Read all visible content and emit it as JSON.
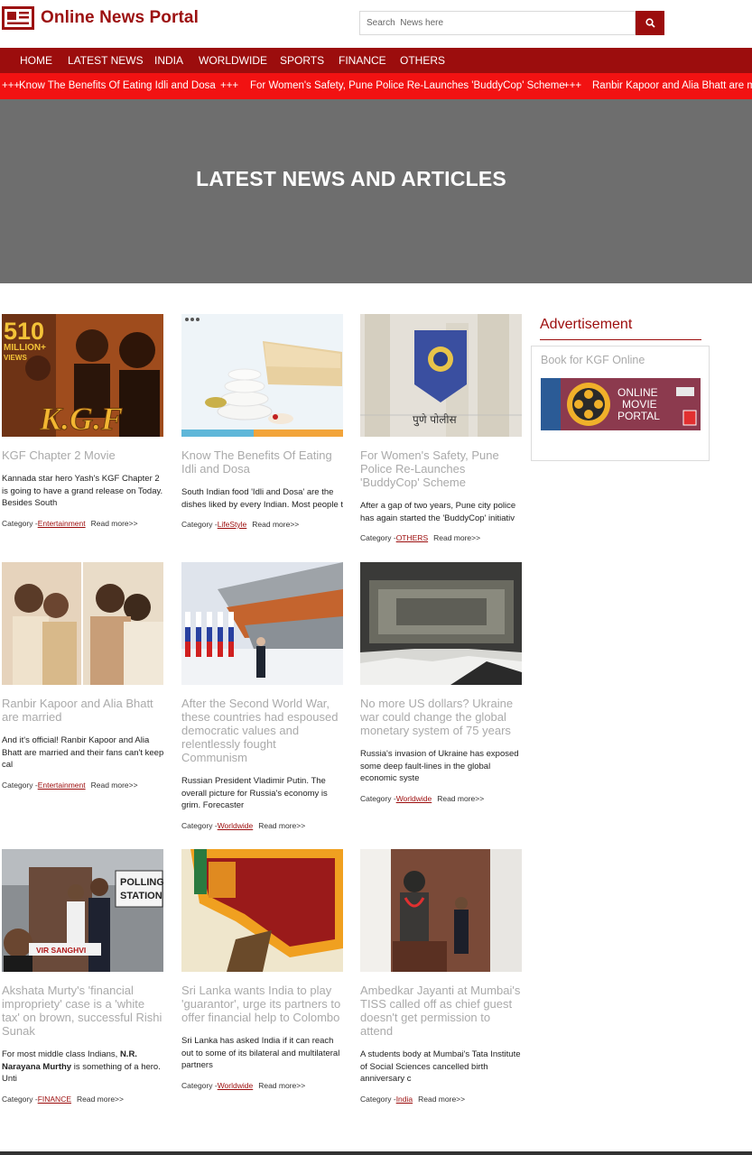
{
  "header": {
    "site_title": "Online News Portal",
    "search_placeholder": "Search  News here",
    "search_icon": "search-icon"
  },
  "nav": [
    "HOME",
    "LATEST NEWS",
    "INDIA",
    "WORLDWIDE",
    "SPORTS",
    "FINANCE",
    "OTHERS"
  ],
  "ticker": {
    "separator": "+++",
    "items": [
      "Know The Benefits Of Eating Idli and Dosa",
      "For Women's Safety, Pune Police Re-Launches 'BuddyCop' Scheme",
      "Ranbir Kapoor and Alia Bhatt are married"
    ]
  },
  "hero": {
    "title": "LATEST NEWS AND ARTICLES"
  },
  "articles": [
    {
      "title": "KGF Chapter 2 Movie",
      "excerpt": "Kannada star hero Yash's KGF Chapter 2 is going to have a grand release on Today. Besides South",
      "category_prefix": "Category -",
      "category": "Entertainment",
      "read_more": "Read more>>"
    },
    {
      "title": "Know The Benefits Of Eating Idli and Dosa",
      "excerpt": "South Indian food 'Idli and Dosa' are the dishes liked by every Indian. Most people t",
      "category_prefix": "Category -",
      "category": "LifeStyle",
      "read_more": "Read more>>"
    },
    {
      "title": "For Women's Safety, Pune Police Re-Launches 'BuddyCop' Scheme",
      "excerpt": "After a gap of two years, Pune city police has again started the 'BuddyCop' initiativ",
      "category_prefix": "Category -",
      "category": "OTHERS",
      "read_more": "Read more>>"
    },
    {
      "title": "Ranbir Kapoor and Alia Bhatt are married",
      "excerpt": "And it's official! Ranbir Kapoor and Alia Bhatt are married and their fans can't keep cal",
      "category_prefix": "Category -",
      "category": "Entertainment",
      "read_more": "Read more>>"
    },
    {
      "title": "After the Second World War, these countries had espoused democratic values and relentlessly fought Communism",
      "excerpt": "Russian President Vladimir Putin. The overall picture for Russia's economy is grim. Forecaster",
      "category_prefix": "Category -",
      "category": "Worldwide",
      "read_more": "Read more>>"
    },
    {
      "title": "No more US dollars? Ukraine war could change the global monetary system of 75 years",
      "excerpt": "Russia's invasion of Ukraine has exposed some deep fault-lines in the global economic syste",
      "category_prefix": "Category -",
      "category": "Worldwide",
      "read_more": "Read more>>"
    },
    {
      "title": "Akshata Murty's 'financial impropriety' case is a 'white tax' on brown, successful Rishi Sunak",
      "excerpt_before": "For most middle class Indians, ",
      "excerpt_bold": "N.R. Narayana Murthy",
      "excerpt_after": " is something of a hero. Unti",
      "category_prefix": "Category -",
      "category": "FINANCE",
      "read_more": "Read more>>"
    },
    {
      "title": "Sri Lanka wants India to play 'guarantor', urge its partners to offer financial help to Colombo",
      "excerpt": "Sri Lanka has asked India if it can reach out to some of its bilateral and multilateral partners",
      "category_prefix": "Category -",
      "category": "Worldwide",
      "read_more": "Read more>>"
    },
    {
      "title": "Ambedkar Jayanti at Mumbai's TISS called off as chief guest doesn't get permission to attend",
      "excerpt": "A students body at Mumbai's Tata Institute of Social Sciences cancelled birth anniversary c",
      "category_prefix": "Category -",
      "category": "India",
      "read_more": "Read more>>"
    }
  ],
  "thumbnail_text": {
    "kgf_badge_number": "510",
    "kgf_badge_line1": "MILLION+",
    "kgf_badge_line2": "VIEWS",
    "kgf_logo": "K.G.F",
    "police_text": "पुणे पोलीस",
    "polling_line1": "POLLING",
    "polling_line2": "STATION",
    "columnist_name": "VIR SANGHVI"
  },
  "sidebar": {
    "ad_heading": "Advertisement",
    "ad_label": "Book for KGF Online",
    "banner_line1": "ONLINE",
    "banner_line2": "MOVIE",
    "banner_line3": "PORTAL"
  },
  "colors": {
    "brand": "#9c0d0d",
    "ticker": "#f21212",
    "hero": "#6e6e6e",
    "title_grey": "#aaaaaa"
  }
}
